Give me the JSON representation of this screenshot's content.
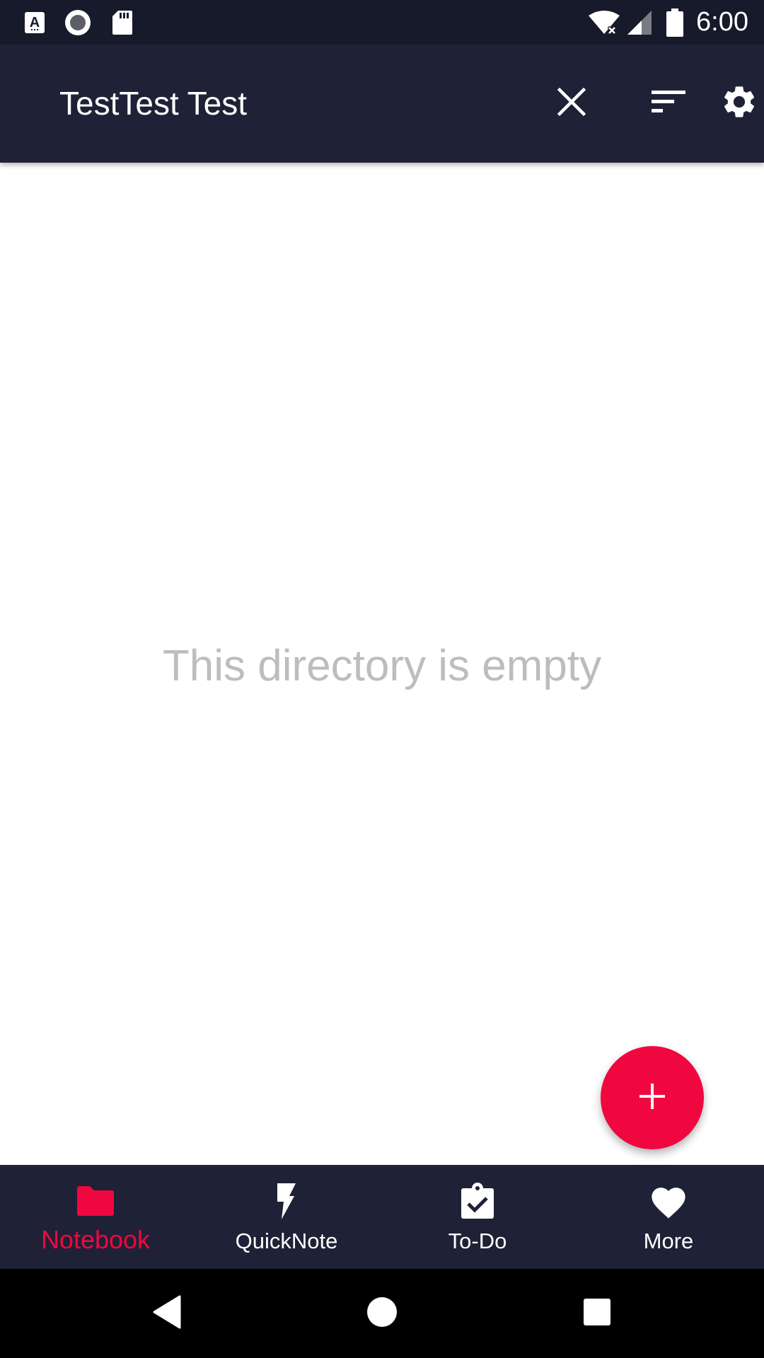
{
  "status_bar": {
    "time": "6:00",
    "left_icons": [
      "accessibility-icon",
      "record-icon",
      "sd-card-icon"
    ],
    "right_icons": [
      "wifi-icon",
      "signal-icon",
      "battery-icon"
    ]
  },
  "app_bar": {
    "title": "TestTest Test",
    "actions": [
      "close-icon",
      "sort-icon",
      "gear-icon"
    ]
  },
  "content": {
    "empty_message": "This directory is empty"
  },
  "fab": {
    "icon": "plus-icon"
  },
  "bottom_nav": {
    "items": [
      {
        "label": "Notebook",
        "icon": "folder-icon",
        "active": true
      },
      {
        "label": "QuickNote",
        "icon": "lightning-icon",
        "active": false
      },
      {
        "label": "To-Do",
        "icon": "clipboard-check-icon",
        "active": false
      },
      {
        "label": "More",
        "icon": "heart-icon",
        "active": false
      }
    ]
  },
  "system_nav": {
    "buttons": [
      "back-icon",
      "home-icon",
      "recents-icon"
    ]
  },
  "colors": {
    "status_bar": "#171a2b",
    "app_bar": "#1f2136",
    "accent": "#f0073f",
    "empty_text": "#bdbdbd",
    "system_nav": "#000000"
  }
}
